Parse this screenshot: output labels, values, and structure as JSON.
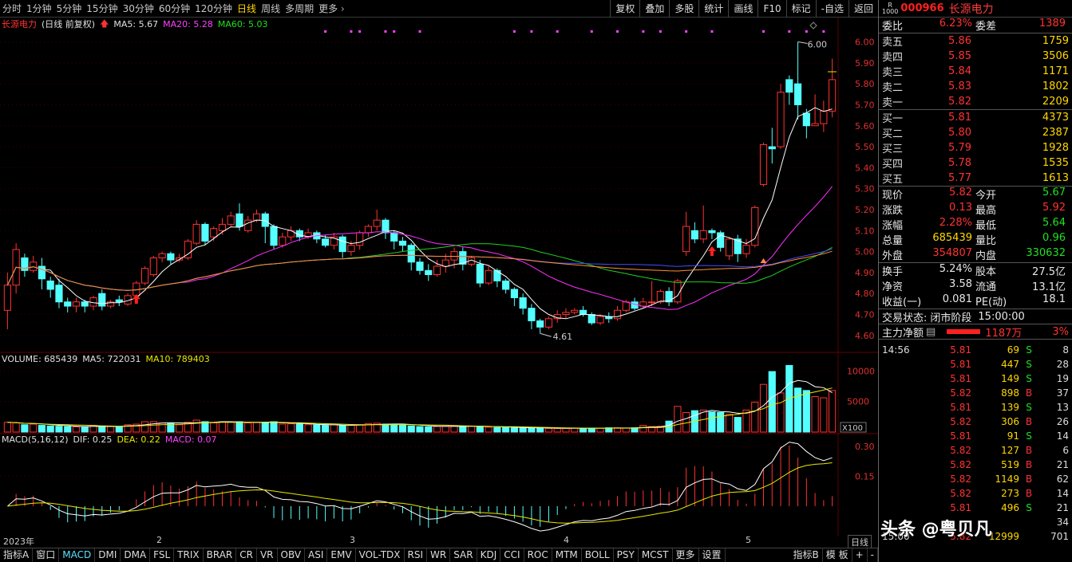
{
  "timeframes": [
    "分时",
    "1分钟",
    "5分钟",
    "15分钟",
    "30分钟",
    "60分钟",
    "120分钟",
    "日线",
    "周线",
    "多周期"
  ],
  "active_timeframe": "日线",
  "more_label": "更多",
  "tools": [
    "复权",
    "叠加",
    "多股",
    "统计",
    "画线",
    "F10",
    "标记",
    "-自选",
    "返回"
  ],
  "stock": {
    "code": "000966",
    "name": "长源电力",
    "badge_top": "R",
    "badge_bottom": "1000",
    "legend_name": "长源电力",
    "legend_mode": "(日线 前复权)"
  },
  "ma": {
    "ma5": "MA5: 5.67",
    "ma20": "MA20: 5.28",
    "ma60": "MA60: 5.03"
  },
  "volume_legend": {
    "label": "VOLUME: 685439",
    "ma5": "MA5: 722031",
    "ma10": "MA10: 789403",
    "unit": "X100"
  },
  "macd_legend": {
    "label": "MACD(5,16,12)",
    "dif": "DIF: 0.25",
    "dea": "DEA: 0.22",
    "macd": "MACD: 0.07"
  },
  "price_axis": [
    "6.00",
    "5.90",
    "5.80",
    "5.70",
    "5.60",
    "5.50",
    "5.40",
    "5.30",
    "5.20",
    "5.10",
    "5.00",
    "4.90",
    "4.80",
    "4.70",
    "4.60"
  ],
  "volume_axis": [
    "10000",
    "5000"
  ],
  "macd_axis": [
    "0.30",
    "0.15"
  ],
  "annotations": {
    "high": "6.00",
    "low": "4.61"
  },
  "dates": [
    "2023年",
    "2",
    "3",
    "4",
    "5"
  ],
  "date_corner": "日线",
  "indicators": [
    "指标A",
    "窗口",
    "MACD",
    "DMI",
    "DMA",
    "FSL",
    "TRIX",
    "BRAR",
    "CR",
    "VR",
    "OBV",
    "ASI",
    "EMV",
    "VOL-TDX",
    "RSI",
    "WR",
    "SAR",
    "KDJ",
    "CCI",
    "ROC",
    "MTM",
    "BOLL",
    "PSY",
    "MCST",
    "更多",
    "设置"
  ],
  "active_indicator": "MACD",
  "indicators_right": [
    "指标B",
    "模 板",
    "+",
    "-"
  ],
  "panel": {
    "weibi": {
      "label": "委比",
      "value": "6.23%",
      "label2": "委差",
      "value2": "1389"
    },
    "asks": [
      {
        "label": "卖五",
        "price": "5.86",
        "vol": "1759"
      },
      {
        "label": "卖四",
        "price": "5.85",
        "vol": "3506"
      },
      {
        "label": "卖三",
        "price": "5.84",
        "vol": "1171"
      },
      {
        "label": "卖二",
        "price": "5.83",
        "vol": "1802"
      },
      {
        "label": "卖一",
        "price": "5.82",
        "vol": "2209"
      }
    ],
    "bids": [
      {
        "label": "买一",
        "price": "5.81",
        "vol": "4373"
      },
      {
        "label": "买二",
        "price": "5.80",
        "vol": "2387"
      },
      {
        "label": "买三",
        "price": "5.79",
        "vol": "1928"
      },
      {
        "label": "买四",
        "price": "5.78",
        "vol": "1535"
      },
      {
        "label": "买五",
        "price": "5.77",
        "vol": "1613"
      }
    ],
    "stats": [
      {
        "l1": "现价",
        "v1": "5.82",
        "c1": "red",
        "l2": "今开",
        "v2": "5.67",
        "c2": "grn"
      },
      {
        "l1": "涨跌",
        "v1": "0.13",
        "c1": "red",
        "l2": "最高",
        "v2": "5.92",
        "c2": "red"
      },
      {
        "l1": "涨幅",
        "v1": "2.28%",
        "c1": "red",
        "l2": "最低",
        "v2": "5.64",
        "c2": "grn"
      },
      {
        "l1": "总量",
        "v1": "685439",
        "c1": "yel",
        "l2": "量比",
        "v2": "0.96",
        "c2": "grn"
      },
      {
        "l1": "外盘",
        "v1": "354807",
        "c1": "red",
        "l2": "内盘",
        "v2": "330632",
        "c2": "grn"
      }
    ],
    "stats2": [
      {
        "l1": "换手",
        "v1": "5.24%",
        "l2": "股本",
        "v2": "27.5亿"
      },
      {
        "l1": "净资",
        "v1": "3.58",
        "l2": "流通",
        "v2": "13.1亿"
      },
      {
        "l1": "收益(一)",
        "v1": "0.081",
        "l2": "PE(动)",
        "v2": "18.1"
      }
    ],
    "status": {
      "label": "交易状态:",
      "value": "闭市阶段",
      "time": "15:00:00"
    },
    "mainflow": {
      "label": "主力净额",
      "value": "1187万",
      "pct": "3%"
    },
    "trades": [
      {
        "t": "14:56",
        "p": "5.81",
        "v": "69",
        "d": "S",
        "n": "8"
      },
      {
        "t": "",
        "p": "5.81",
        "v": "447",
        "d": "S",
        "n": "28"
      },
      {
        "t": "",
        "p": "5.81",
        "v": "149",
        "d": "S",
        "n": "19"
      },
      {
        "t": "",
        "p": "5.82",
        "v": "898",
        "d": "B",
        "n": "37"
      },
      {
        "t": "",
        "p": "5.81",
        "v": "139",
        "d": "S",
        "n": "13"
      },
      {
        "t": "",
        "p": "5.82",
        "v": "306",
        "d": "B",
        "n": "26"
      },
      {
        "t": "",
        "p": "5.81",
        "v": "91",
        "d": "S",
        "n": "14"
      },
      {
        "t": "",
        "p": "5.82",
        "v": "127",
        "d": "B",
        "n": "6"
      },
      {
        "t": "",
        "p": "5.82",
        "v": "519",
        "d": "B",
        "n": "21"
      },
      {
        "t": "",
        "p": "5.82",
        "v": "1149",
        "d": "B",
        "n": "62"
      },
      {
        "t": "",
        "p": "5.82",
        "v": "273",
        "d": "B",
        "n": "14"
      },
      {
        "t": "",
        "p": "5.81",
        "v": "496",
        "d": "S",
        "n": "21"
      },
      {
        "t": "",
        "p": "",
        "v": "",
        "d": "",
        "n": "34"
      },
      {
        "t": "15:00",
        "p": "5.82",
        "v": "12999",
        "d": "",
        "n": "701"
      }
    ]
  },
  "watermark": "头条 @粤贝凡",
  "chart_data": {
    "type": "candlestick",
    "y_range": [
      4.55,
      6.04
    ],
    "candles": [
      [
        4.72,
        4.84,
        4.63,
        4.9
      ],
      [
        4.84,
        5.01,
        4.8,
        5.04
      ],
      [
        4.97,
        4.91,
        4.88,
        4.99
      ],
      [
        4.91,
        4.95,
        4.9,
        4.98
      ],
      [
        4.93,
        4.87,
        4.82,
        4.97
      ],
      [
        4.86,
        4.82,
        4.78,
        4.88
      ],
      [
        4.84,
        4.76,
        4.73,
        4.87
      ],
      [
        4.76,
        4.74,
        4.71,
        4.78
      ],
      [
        4.74,
        4.76,
        4.71,
        4.78
      ],
      [
        4.76,
        4.74,
        4.71,
        4.77
      ],
      [
        4.74,
        4.78,
        4.72,
        4.79
      ],
      [
        4.8,
        4.74,
        4.72,
        4.82
      ],
      [
        4.74,
        4.76,
        4.73,
        4.77
      ],
      [
        4.77,
        4.76,
        4.74,
        4.79
      ],
      [
        4.75,
        4.79,
        4.74,
        4.8
      ],
      [
        4.79,
        4.85,
        4.78,
        4.86
      ],
      [
        4.85,
        4.92,
        4.84,
        4.93
      ],
      [
        4.89,
        4.97,
        4.88,
        4.98
      ],
      [
        4.97,
        4.99,
        4.95,
        5.0
      ],
      [
        4.99,
        4.96,
        4.94,
        5.0
      ],
      [
        4.96,
        4.97,
        4.95,
        4.99
      ],
      [
        4.97,
        5.05,
        4.96,
        5.06
      ],
      [
        5.04,
        5.13,
        5.03,
        5.15
      ],
      [
        5.13,
        5.05,
        5.03,
        5.14
      ],
      [
        5.07,
        5.11,
        5.05,
        5.12
      ],
      [
        5.1,
        5.13,
        5.08,
        5.16
      ],
      [
        5.13,
        5.17,
        5.12,
        5.19
      ],
      [
        5.18,
        5.12,
        5.1,
        5.23
      ],
      [
        5.1,
        5.15,
        5.09,
        5.17
      ],
      [
        5.15,
        5.18,
        5.14,
        5.2
      ],
      [
        5.18,
        5.12,
        5.04,
        5.19
      ],
      [
        5.12,
        5.03,
        5.01,
        5.13
      ],
      [
        5.03,
        5.07,
        5.02,
        5.09
      ],
      [
        5.07,
        5.1,
        5.05,
        5.12
      ],
      [
        5.1,
        5.07,
        5.05,
        5.11
      ],
      [
        5.07,
        5.09,
        5.06,
        5.11
      ],
      [
        5.09,
        5.06,
        5.04,
        5.1
      ],
      [
        5.06,
        5.03,
        5.02,
        5.08
      ],
      [
        5.03,
        5.07,
        5.01,
        5.09
      ],
      [
        5.07,
        5.0,
        4.97,
        5.08
      ],
      [
        5.0,
        5.03,
        4.98,
        5.05
      ],
      [
        5.03,
        5.09,
        5.01,
        5.1
      ],
      [
        5.09,
        5.12,
        5.07,
        5.13
      ],
      [
        5.12,
        5.15,
        5.1,
        5.2
      ],
      [
        5.15,
        5.09,
        5.06,
        5.16
      ],
      [
        5.09,
        5.05,
        5.01,
        5.1
      ],
      [
        5.05,
        5.03,
        5.0,
        5.07
      ],
      [
        5.03,
        4.95,
        4.91,
        5.04
      ],
      [
        4.95,
        4.91,
        4.89,
        4.97
      ],
      [
        4.91,
        4.89,
        4.86,
        4.94
      ],
      [
        4.89,
        4.93,
        4.88,
        4.96
      ],
      [
        4.93,
        4.96,
        4.9,
        4.99
      ],
      [
        4.96,
        5.0,
        4.92,
        5.02
      ],
      [
        5.0,
        4.94,
        4.91,
        5.02
      ],
      [
        4.94,
        4.97,
        4.93,
        4.98
      ],
      [
        4.94,
        4.85,
        4.83,
        4.96
      ],
      [
        4.85,
        4.91,
        4.84,
        4.93
      ],
      [
        4.91,
        4.86,
        4.83,
        4.92
      ],
      [
        4.86,
        4.82,
        4.8,
        4.87
      ],
      [
        4.82,
        4.78,
        4.74,
        4.83
      ],
      [
        4.78,
        4.73,
        4.7,
        4.8
      ],
      [
        4.73,
        4.67,
        4.63,
        4.75
      ],
      [
        4.67,
        4.64,
        4.61,
        4.68
      ],
      [
        4.64,
        4.68,
        4.63,
        4.69
      ],
      [
        4.68,
        4.7,
        4.66,
        4.72
      ],
      [
        4.7,
        4.71,
        4.68,
        4.73
      ],
      [
        4.71,
        4.72,
        4.7,
        4.73
      ],
      [
        4.72,
        4.7,
        4.69,
        4.74
      ],
      [
        4.7,
        4.66,
        4.65,
        4.71
      ],
      [
        4.66,
        4.69,
        4.65,
        4.7
      ],
      [
        4.69,
        4.68,
        4.66,
        4.71
      ],
      [
        4.68,
        4.72,
        4.67,
        4.74
      ],
      [
        4.72,
        4.76,
        4.71,
        4.77
      ],
      [
        4.76,
        4.73,
        4.72,
        4.78
      ],
      [
        4.74,
        4.76,
        4.73,
        4.78
      ],
      [
        4.76,
        4.76,
        4.74,
        4.86
      ],
      [
        4.76,
        4.81,
        4.75,
        4.82
      ],
      [
        4.81,
        4.76,
        4.74,
        4.83
      ],
      [
        4.76,
        4.86,
        4.75,
        4.87
      ],
      [
        5.0,
        5.12,
        4.98,
        5.19
      ],
      [
        5.1,
        5.06,
        5.04,
        5.14
      ],
      [
        5.06,
        5.1,
        5.04,
        5.22
      ],
      [
        5.1,
        5.09,
        5.06,
        5.11
      ],
      [
        5.09,
        5.02,
        5.0,
        5.1
      ],
      [
        4.98,
        5.06,
        4.96,
        5.07
      ],
      [
        5.06,
        4.99,
        4.95,
        5.08
      ],
      [
        4.99,
        5.03,
        4.97,
        5.06
      ],
      [
        5.03,
        5.21,
        5.02,
        5.22
      ],
      [
        5.32,
        5.51,
        5.31,
        5.52
      ],
      [
        5.5,
        5.49,
        5.42,
        5.59
      ],
      [
        5.5,
        5.76,
        5.49,
        5.8
      ],
      [
        5.82,
        5.76,
        5.7,
        5.84
      ],
      [
        5.8,
        5.7,
        5.63,
        6.0
      ],
      [
        5.66,
        5.6,
        5.54,
        5.68
      ],
      [
        5.6,
        5.61,
        5.6,
        5.75
      ],
      [
        5.61,
        5.67,
        5.57,
        5.72
      ],
      [
        5.67,
        5.82,
        5.64,
        5.92
      ]
    ],
    "volume": [
      1600,
      1500,
      1200,
      1300,
      1100,
      1000,
      950,
      900,
      850,
      800,
      1100,
      1000,
      900,
      850,
      1200,
      1300,
      1700,
      1700,
      1500,
      1400,
      1200,
      1600,
      1950,
      1700,
      1500,
      1700,
      1600,
      1700,
      1500,
      1550,
      1500,
      1700,
      1300,
      1350,
      1300,
      1200,
      1150,
      1100,
      1200,
      1050,
      1100,
      1200,
      1400,
      1450,
      1300,
      1250,
      1200,
      1000,
      900,
      850,
      900,
      950,
      1050,
      900,
      950,
      950,
      800,
      750,
      800,
      700,
      650,
      650,
      700,
      600,
      600,
      600,
      650,
      600,
      650,
      650,
      700,
      700,
      650,
      700,
      1100,
      900,
      950,
      1800,
      4200,
      3200,
      3500,
      3600,
      3300,
      3200,
      2900,
      2400,
      3600,
      4900,
      7800,
      9900,
      6400,
      10900,
      7200,
      6800,
      5800,
      5600,
      6800
    ]
  }
}
